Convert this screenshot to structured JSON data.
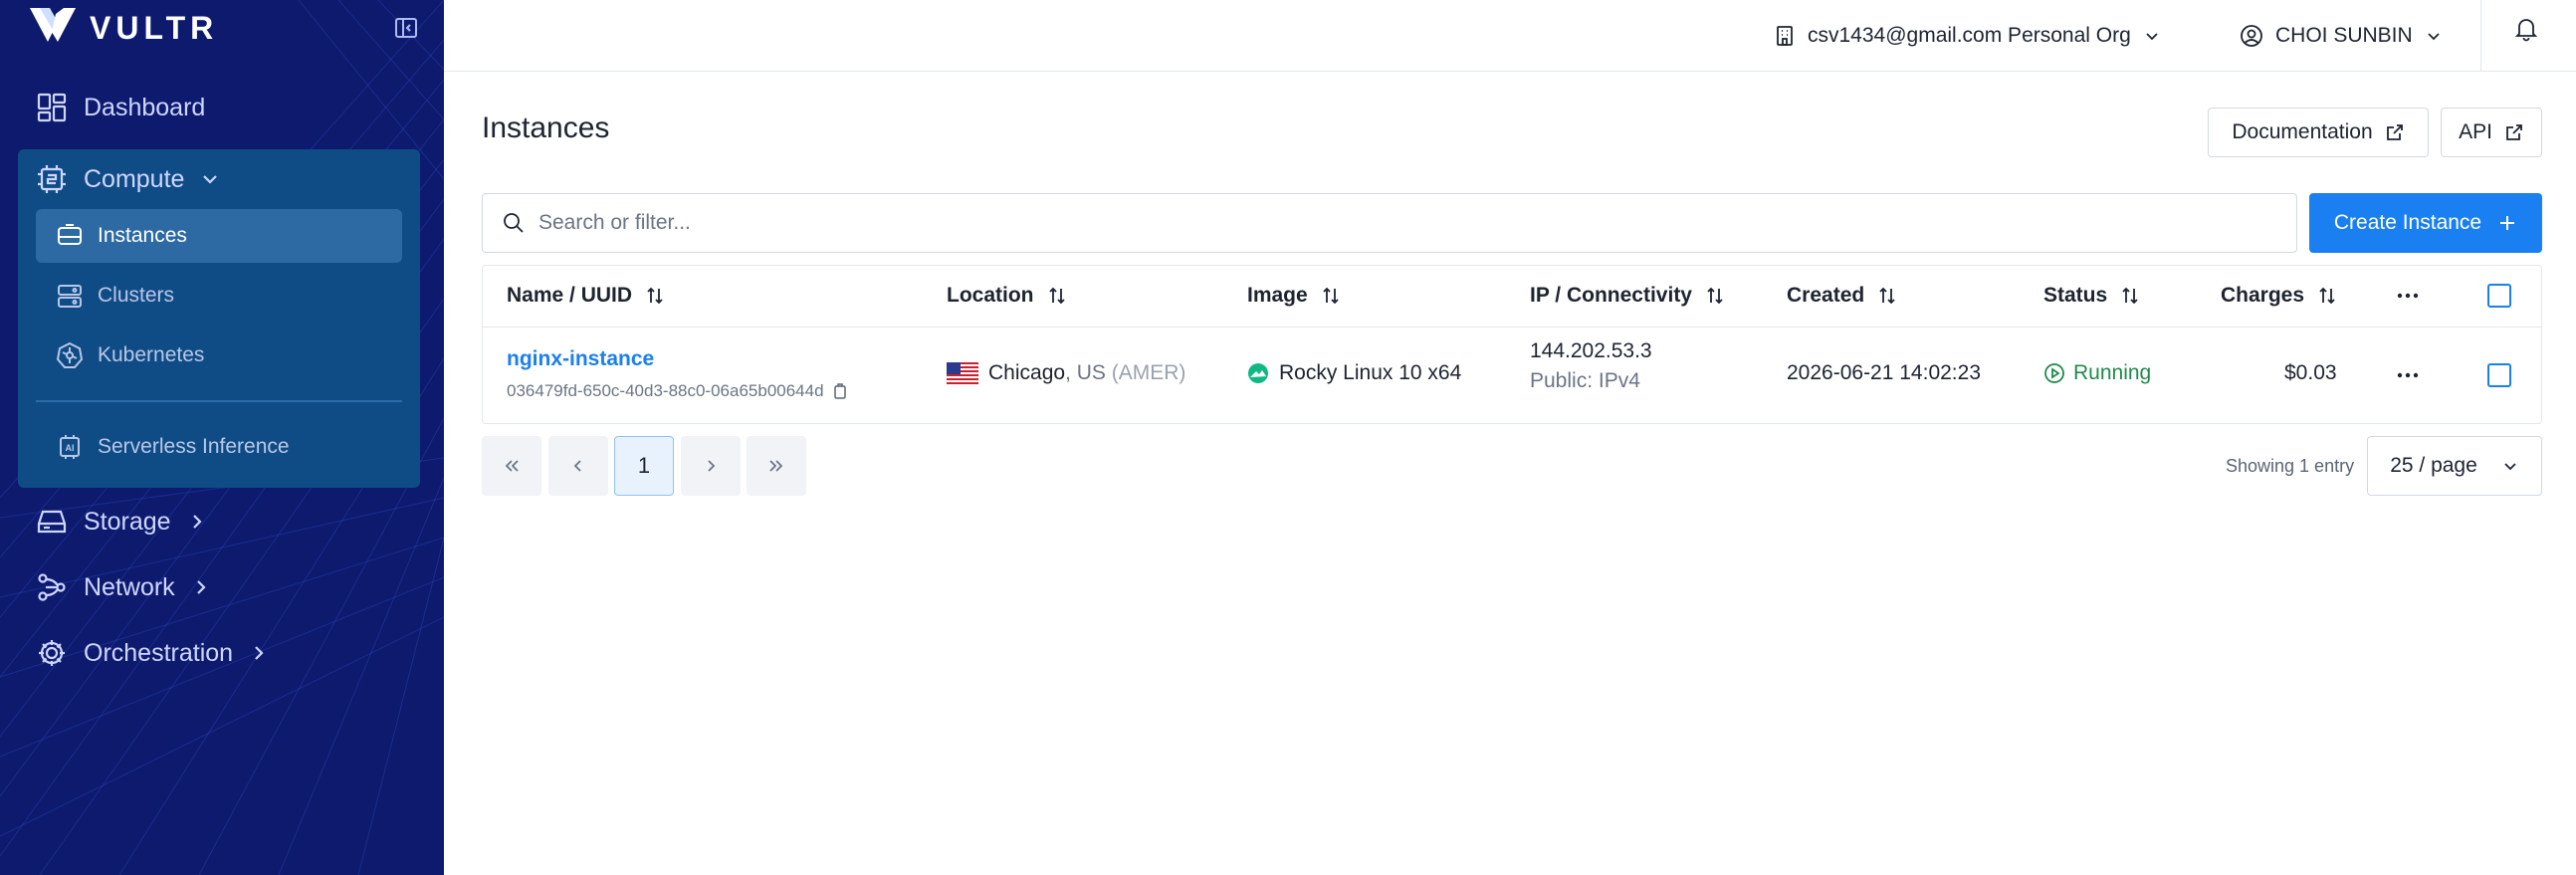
{
  "brand": {
    "name": "VULTR",
    "accent": "#1a7ff0",
    "sidebar_bg": "#0d1a6e"
  },
  "sidebar": {
    "items": [
      {
        "label": "Dashboard",
        "icon": "dashboard-icon"
      },
      {
        "label": "Compute",
        "icon": "compute-icon",
        "expanded": true
      },
      {
        "label": "Storage",
        "icon": "storage-icon"
      },
      {
        "label": "Network",
        "icon": "network-icon"
      },
      {
        "label": "Orchestration",
        "icon": "orchestration-icon"
      }
    ],
    "compute_subitems": [
      {
        "label": "Instances",
        "icon": "instances-icon",
        "active": true
      },
      {
        "label": "Clusters",
        "icon": "clusters-icon"
      },
      {
        "label": "Kubernetes",
        "icon": "kubernetes-icon"
      },
      {
        "label": "Serverless Inference",
        "icon": "ai-chip-icon"
      }
    ]
  },
  "topbar": {
    "org": "csv1434@gmail.com Personal Org",
    "user": "CHOI SUNBIN"
  },
  "page": {
    "title": "Instances",
    "documentation_label": "Documentation",
    "api_label": "API",
    "search_placeholder": "Search or filter...",
    "create_label": "Create Instance"
  },
  "table": {
    "columns": [
      "Name / UUID",
      "Location",
      "Image",
      "IP / Connectivity",
      "Created",
      "Status",
      "Charges"
    ],
    "rows": [
      {
        "name": "nginx-instance",
        "uuid": "036479fd-650c-40d3-88c0-06a65b00644d",
        "city": "Chicago",
        "country": ", US",
        "region": " (AMER)",
        "image": "Rocky Linux 10 x64",
        "ip": "144.202.53.3",
        "connectivity": "Public: IPv4",
        "created": "2026-06-21 14:02:23",
        "status": "Running",
        "charges": "$0.03"
      }
    ]
  },
  "pagination": {
    "current_page": "1",
    "showing": "Showing 1 entry",
    "per_page": "25 / page"
  }
}
